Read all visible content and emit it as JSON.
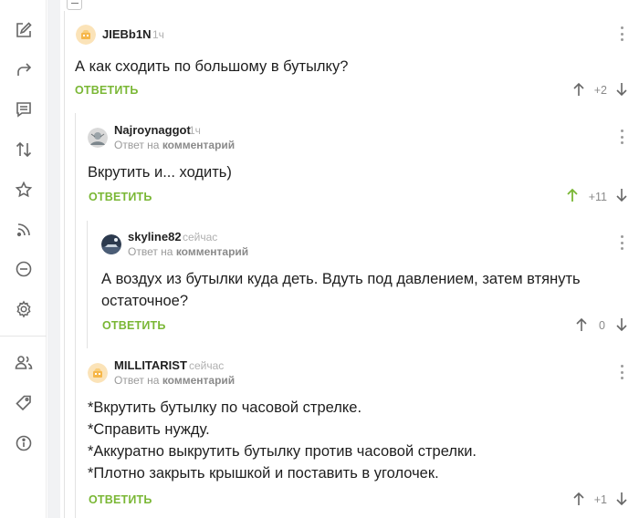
{
  "sidebar": {
    "icons": [
      "edit-icon",
      "share-icon",
      "comments-icon",
      "sort-icon",
      "star-icon",
      "rss-icon",
      "ignore-icon",
      "settings-icon",
      "users-icon",
      "tag-icon",
      "info-icon"
    ]
  },
  "comments": [
    {
      "author": "JIEBb1N",
      "time": "1ч",
      "text": "А как сходить по большому в бутылку?",
      "reply_label": "ОТВЕТИТЬ",
      "rating": "+2"
    },
    {
      "author": "Najroynaggot",
      "time": "1ч",
      "reply_prefix": "Ответ на",
      "reply_target": "комментарий",
      "text": "Вкрутить и... ходить)",
      "reply_label": "ОТВЕТИТЬ",
      "rating": "+11"
    },
    {
      "author": "skyline82",
      "time": "сейчас",
      "reply_prefix": "Ответ на",
      "reply_target": "комментарий",
      "text_lines": [
        "А воздух из бутылки куда деть. Вдуть под давлением, затем втянуть",
        "остаточное?"
      ],
      "reply_label": "ОТВЕТИТЬ",
      "rating": "0"
    },
    {
      "author": "MILLITARIST",
      "time": "сейчас",
      "reply_prefix": "Ответ на",
      "reply_target": "комментарий",
      "text_lines": [
        "*Вкрутить бутылку по часовой стрелке.",
        "*Справить нужду.",
        "*Аккуратно выкрутить бутылку против часовой стрелки.",
        "*Плотно закрыть крышкой и поставить в уголочек."
      ],
      "reply_label": "ОТВЕТИТЬ",
      "rating": "+1"
    }
  ],
  "colors": {
    "accent_green": "#7ab735",
    "upvoted_green": "#7ab735",
    "icon_grey": "#6f6f6f"
  }
}
